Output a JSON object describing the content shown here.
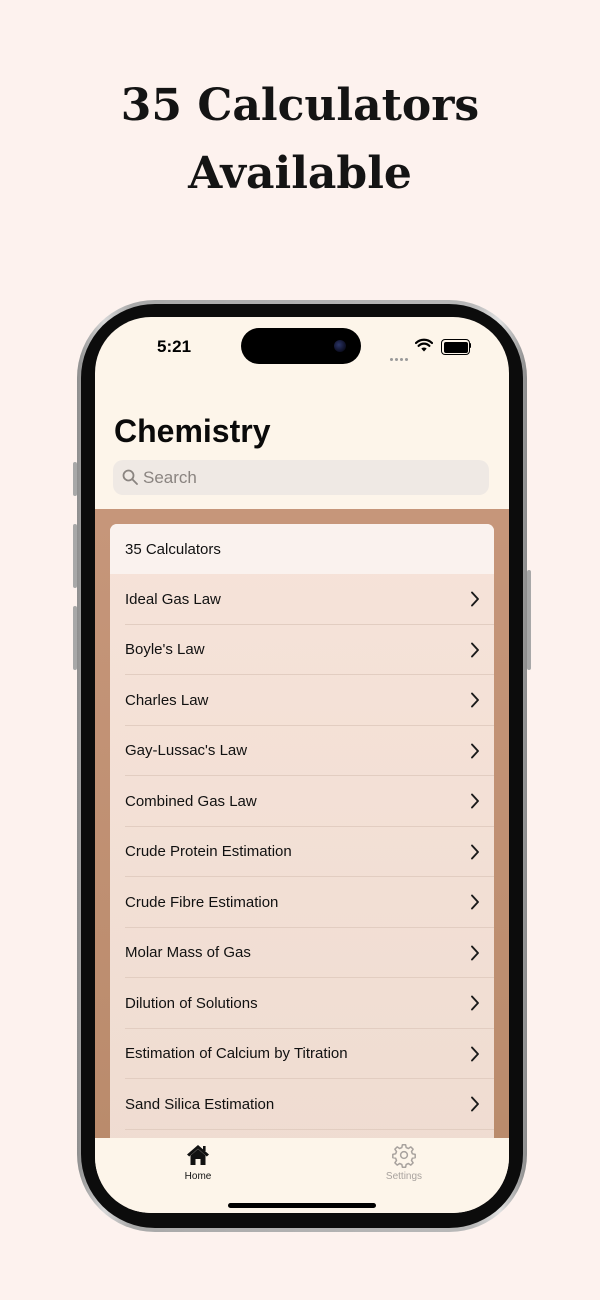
{
  "promo": {
    "line1": "35 Calculators",
    "line2": "Available"
  },
  "status_bar": {
    "time": "5:21"
  },
  "nav": {
    "title": "Chemistry"
  },
  "search": {
    "placeholder": "Search"
  },
  "list": {
    "header": "35 Calculators",
    "items": [
      {
        "label": "Ideal Gas Law"
      },
      {
        "label": "Boyle's Law"
      },
      {
        "label": "Charles Law"
      },
      {
        "label": "Gay-Lussac's Law"
      },
      {
        "label": "Combined Gas Law"
      },
      {
        "label": "Crude Protein Estimation"
      },
      {
        "label": "Crude Fibre Estimation"
      },
      {
        "label": "Molar Mass of Gas"
      },
      {
        "label": "Dilution of Solutions"
      },
      {
        "label": "Estimation of Calcium by Titration"
      },
      {
        "label": "Sand Silica Estimation"
      }
    ]
  },
  "tab_bar": {
    "home_label": "Home",
    "settings_label": "Settings",
    "home_icon": "house-icon",
    "settings_icon": "gear-icon"
  },
  "colors": {
    "page_background": "#fdf2ee",
    "app_background": "#fdf5ea",
    "content_background": "#c6967a",
    "list_background": "#f6e3d9",
    "active_tab": "#111111",
    "inactive_tab": "#a8a29e"
  }
}
